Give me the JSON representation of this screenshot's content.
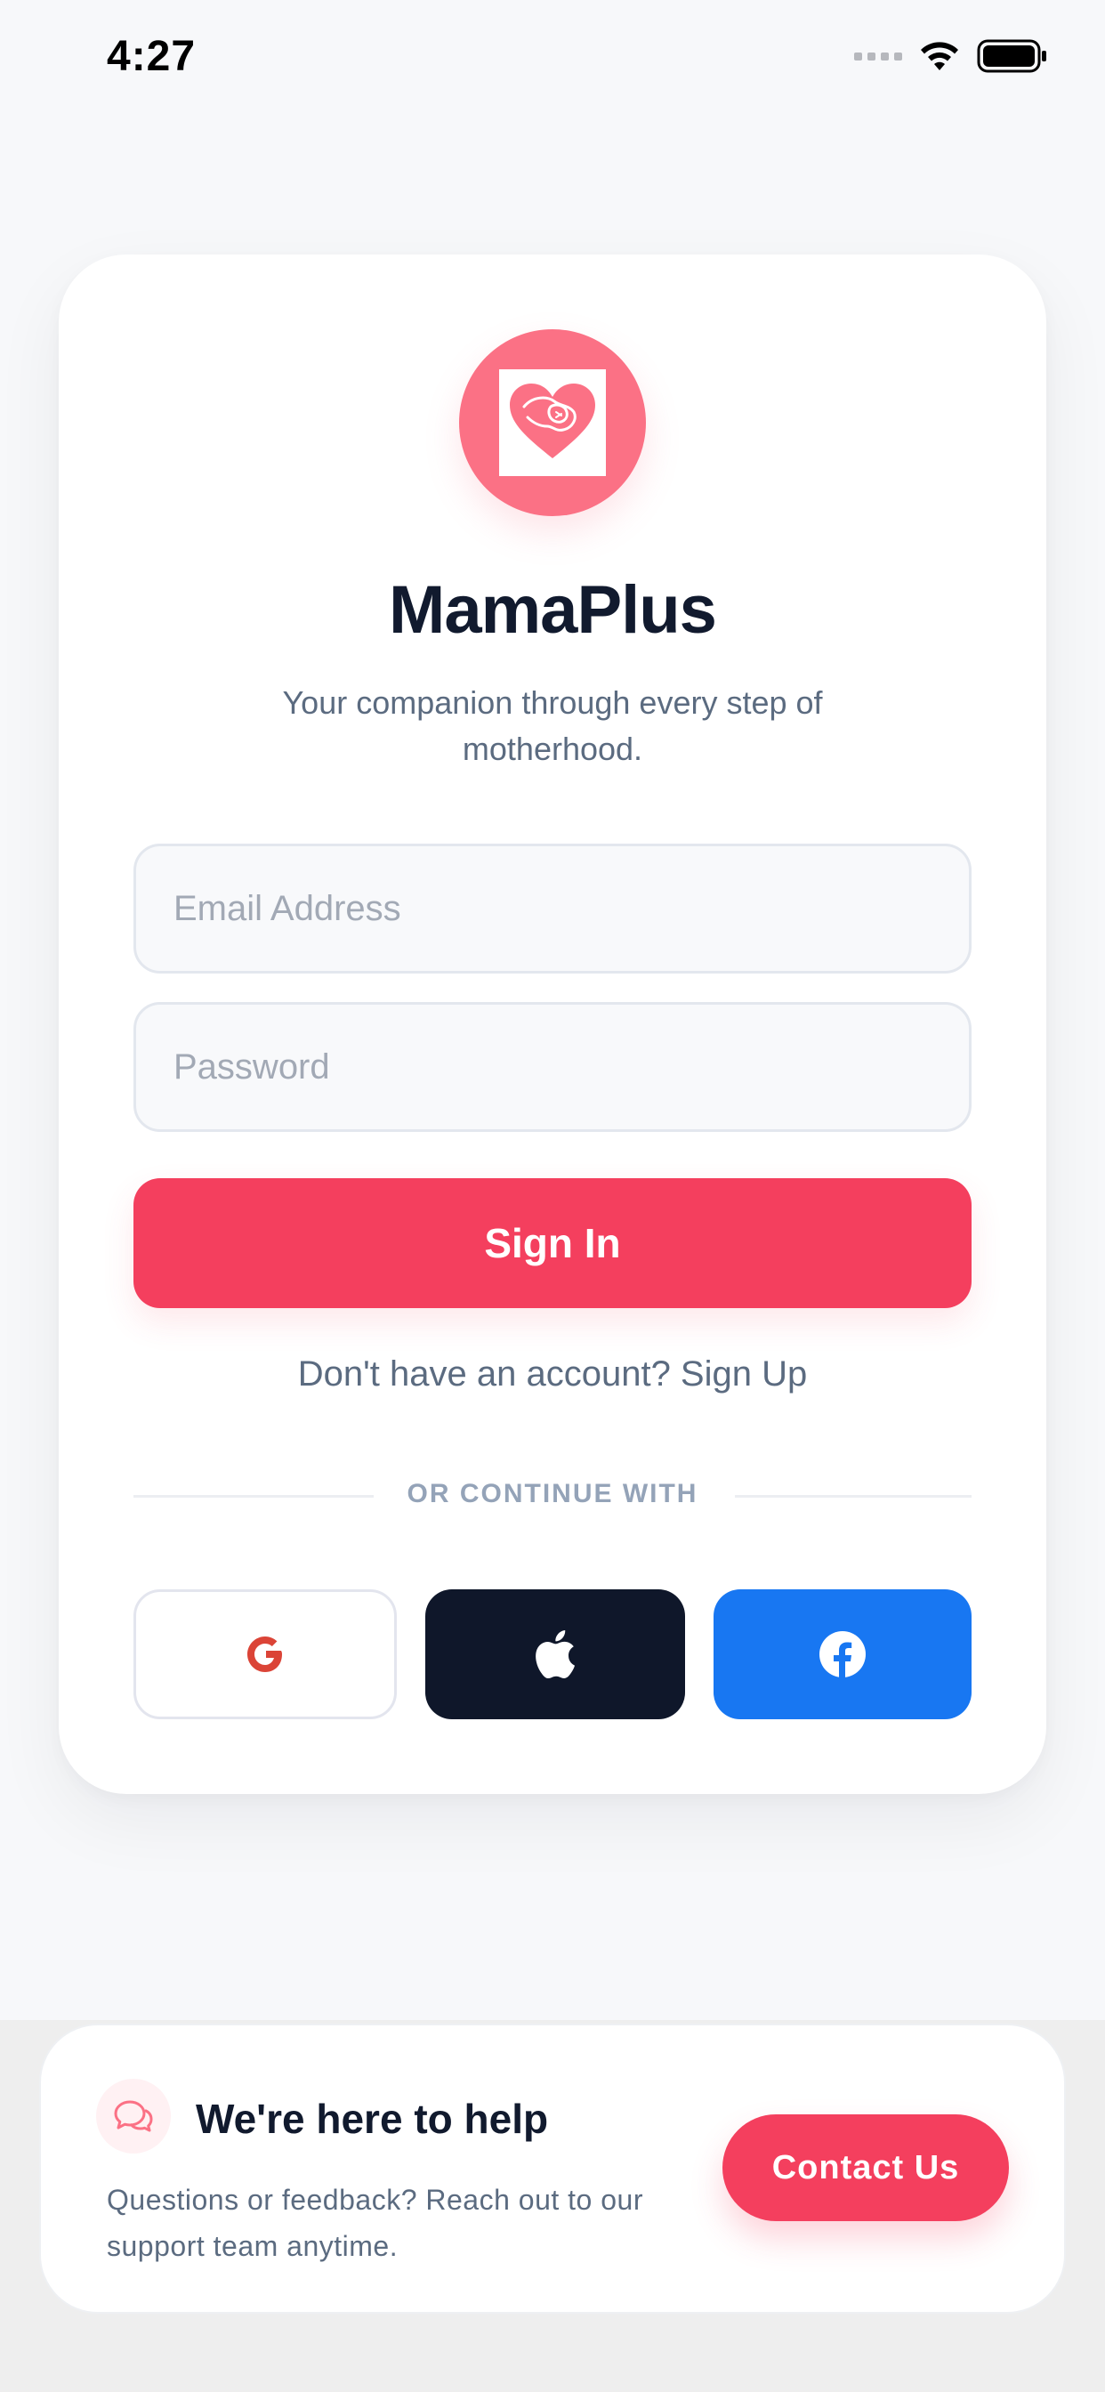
{
  "status_bar": {
    "time": "4:27"
  },
  "brand": {
    "name": "MamaPlus",
    "tagline": "Your companion through every step of motherhood.",
    "accent": "#f43f5e",
    "logo_bg": "#fb7185"
  },
  "form": {
    "email": {
      "placeholder": "Email Address",
      "value": ""
    },
    "password": {
      "placeholder": "Password",
      "value": ""
    },
    "sign_in_label": "Sign In",
    "signup_prompt": "Don't have an account? Sign Up"
  },
  "social": {
    "divider_label": "OR CONTINUE WITH",
    "providers": [
      {
        "name": "Google",
        "icon": "google-icon",
        "color": "#ffffff"
      },
      {
        "name": "Apple",
        "icon": "apple-icon",
        "color": "#0f172a"
      },
      {
        "name": "Facebook",
        "icon": "facebook-icon",
        "color": "#1877f2"
      }
    ]
  },
  "help": {
    "icon": "chat-bubbles-icon",
    "title": "We're here to help",
    "text": "Questions or feedback? Reach out to our support team anytime.",
    "contact_label": "Contact Us"
  }
}
